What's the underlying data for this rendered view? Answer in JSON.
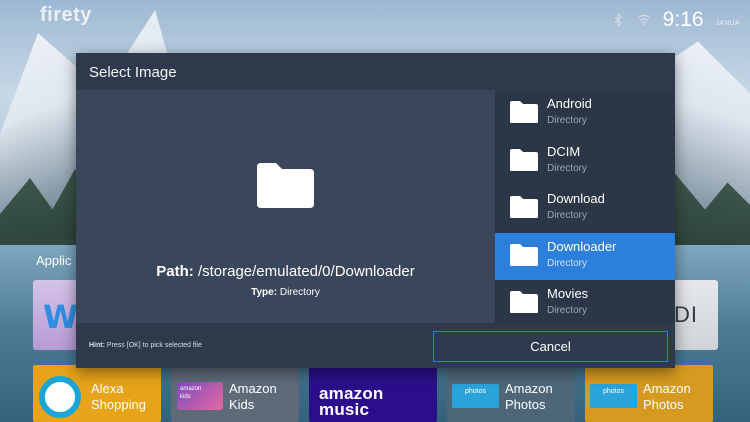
{
  "topbar": {
    "brand": "firety",
    "time": "9:16",
    "date": "JANUA"
  },
  "home": {
    "apps_label": "Applic",
    "left_tile_letter": "W",
    "right_tile_text": "DI",
    "tiles": [
      {
        "label": "Alexa\nShopping",
        "icon": "alexa-ring-icon"
      },
      {
        "label": "Amazon\nKids",
        "thumb": "amazon\nkids"
      },
      {
        "label": "amazon music"
      },
      {
        "label": "Amazon\nPhotos",
        "thumb": "photos"
      },
      {
        "label": "Amazon\nPhotos",
        "thumb": "photos"
      }
    ]
  },
  "dialog": {
    "title": "Select Image",
    "path_label": "Path:",
    "path_value": "/storage/emulated/0/Downloader",
    "type_label": "Type:",
    "type_value": "Directory",
    "hint_label": "Hint:",
    "hint_text": "Press [OK] to pick selected file",
    "cancel_label": "Cancel",
    "files": [
      {
        "name": "Android",
        "type": "Directory",
        "selected": false
      },
      {
        "name": "DCIM",
        "type": "Directory",
        "selected": false
      },
      {
        "name": "Download",
        "type": "Directory",
        "selected": false
      },
      {
        "name": "Downloader",
        "type": "Directory",
        "selected": true
      },
      {
        "name": "Movies",
        "type": "Directory",
        "selected": false
      }
    ]
  },
  "colors": {
    "dialog_bg": "#2e3a4c",
    "preview_bg": "#3a465a",
    "selected": "#2d7fdc",
    "muted_text": "#9aa6b6"
  }
}
